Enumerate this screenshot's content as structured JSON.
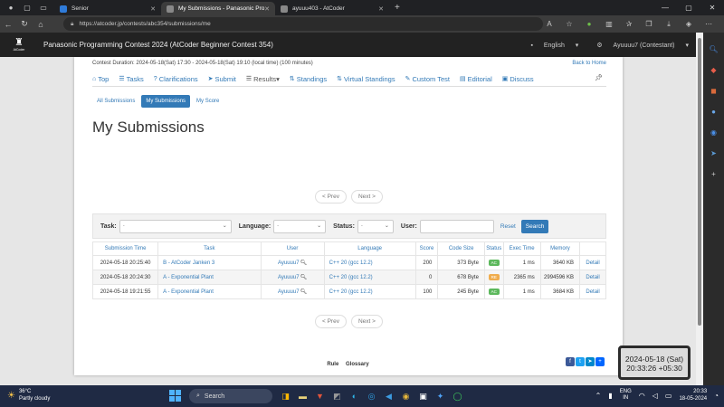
{
  "browser": {
    "tabs": [
      {
        "title": "Senior",
        "fav_color": "#2f7bd9",
        "active": false
      },
      {
        "title": "My Submissions - Panasonic Pro",
        "fav_color": "#888888",
        "active": true
      },
      {
        "title": "ayuuu403 - AtCoder",
        "fav_color": "#888888",
        "active": false
      }
    ],
    "url": "https://atcoder.jp/contests/abc354/submissions/me"
  },
  "header": {
    "logo_text": "AtCoder",
    "contest_name": "Panasonic Programming Contest 2024 (AtCoder Beginner Contest 354)",
    "language": "English",
    "user": "Ayuuuu7 (Contestant)"
  },
  "contest": {
    "duration": "Contest Duration: 2024-05-18(Sat) 17:30 - 2024-05-18(Sat) 19:10 (local time) (100 minutes)",
    "back_home": "Back to Home"
  },
  "nav_tabs": [
    {
      "label": "Top",
      "icon": "home-icon",
      "glyph": "⌂"
    },
    {
      "label": "Tasks",
      "icon": "list-icon",
      "glyph": "☰"
    },
    {
      "label": "Clarifications",
      "icon": "question-icon",
      "glyph": "?"
    },
    {
      "label": "Submit",
      "icon": "send-icon",
      "glyph": "➤"
    },
    {
      "label": "Results",
      "icon": "results-icon",
      "glyph": "☰"
    },
    {
      "label": "Standings",
      "icon": "standings-icon",
      "glyph": "⇅"
    },
    {
      "label": "Virtual Standings",
      "icon": "virtual-standings-icon",
      "glyph": "⇅"
    },
    {
      "label": "Custom Test",
      "icon": "wrench-icon",
      "glyph": "✎"
    },
    {
      "label": "Editorial",
      "icon": "book-icon",
      "glyph": "▤"
    },
    {
      "label": "Discuss",
      "icon": "chat-icon",
      "glyph": "▣"
    }
  ],
  "sub_tabs": [
    "All Submissions",
    "My Submissions",
    "My Score"
  ],
  "page_title": "My Submissions",
  "pager": {
    "prev": "< Prev",
    "next": "Next >"
  },
  "filter": {
    "task_label": "Task:",
    "language_label": "Language:",
    "status_label": "Status:",
    "user_label": "User:",
    "placeholder": "-",
    "reset": "Reset",
    "search": "Search"
  },
  "table": {
    "headers": [
      "Submission Time",
      "Task",
      "User",
      "Language",
      "Score",
      "Code Size",
      "Status",
      "Exec Time",
      "Memory",
      ""
    ],
    "rows": [
      {
        "time": "2024-05-18 20:25:40",
        "task": "B - AtCoder Janken 3",
        "user": "Ayuuuu7",
        "language": "C++ 20 (gcc 12.2)",
        "score": "200",
        "code_size": "373 Byte",
        "status": "AC",
        "status_color": "#5cb85c",
        "exec": "1 ms",
        "memory": "3640 KB",
        "detail": "Detail"
      },
      {
        "time": "2024-05-18 20:24:30",
        "task": "A - Exponential Plant",
        "user": "Ayuuuu7",
        "language": "C++ 20 (gcc 12.2)",
        "score": "0",
        "code_size": "678 Byte",
        "status": "RE",
        "status_color": "#f0ad4e",
        "exec": "2365 ms",
        "memory": "2994596 KB",
        "detail": "Detail"
      },
      {
        "time": "2024-05-18 19:21:55",
        "task": "A - Exponential Plant",
        "user": "Ayuuuu7",
        "language": "C++ 20 (gcc 12.2)",
        "score": "100",
        "code_size": "245 Byte",
        "status": "AC",
        "status_color": "#5cb85c",
        "exec": "1 ms",
        "memory": "3684 KB",
        "detail": "Detail"
      }
    ]
  },
  "footer": {
    "links": [
      "Rule",
      "Glossary"
    ]
  },
  "clock_tooltip": {
    "date": "2024-05-18 (Sat)",
    "time": "20:33:26 +05:30"
  },
  "taskbar": {
    "weather_temp": "36°C",
    "weather_desc": "Partly cloudy",
    "search": "Search",
    "lang_1": "ENG",
    "lang_2": "IN",
    "time": "20:33",
    "date": "18-05-2024"
  }
}
